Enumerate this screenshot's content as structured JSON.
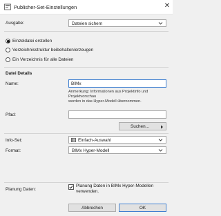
{
  "window": {
    "title": "Publisher-Set-Einstellungen",
    "close_glyph": "✕"
  },
  "ausgabe": {
    "label": "Ausgabe:",
    "value": "Dateien sichern"
  },
  "radios": [
    {
      "label": "Einzeldatei erstellen",
      "selected": true
    },
    {
      "label": "Verzeichnisstruktur beibehalten/erzeugen",
      "selected": false
    },
    {
      "label": "Ein Verzeichnis für alle Dateien",
      "selected": false
    }
  ],
  "details": {
    "heading": "Datei Details",
    "name_label": "Name:",
    "name_value": "BIMx",
    "note_line1": "Anmerkung: Informationen aus Projektinfo und Projektvorschau",
    "note_line2": "werden in das Hyper-Modell übernommen.",
    "pfad_label": "Pfad:",
    "pfad_value": "",
    "browse_label": "Suchen...",
    "infoset_label": "Info-Set:",
    "infoset_value": "Einfach-Auswahl",
    "format_label": "Format:",
    "format_value": "BIMx Hyper-Modell"
  },
  "planung": {
    "label": "Planung Daten:",
    "checkbox_line1": "Planung Daten in BIMx Hyper-Modellen",
    "checkbox_line2": "verwenden.",
    "checked": true
  },
  "buttons": {
    "cancel": "Abbrechen",
    "ok": "OK"
  },
  "icons": {
    "app": "publisher-app-icon",
    "close": "close-icon",
    "chevron": "chevron-down-icon",
    "browse_arrow": "triangle-right-icon",
    "infoset": "grid-table-icon",
    "check": "checkmark-icon"
  }
}
